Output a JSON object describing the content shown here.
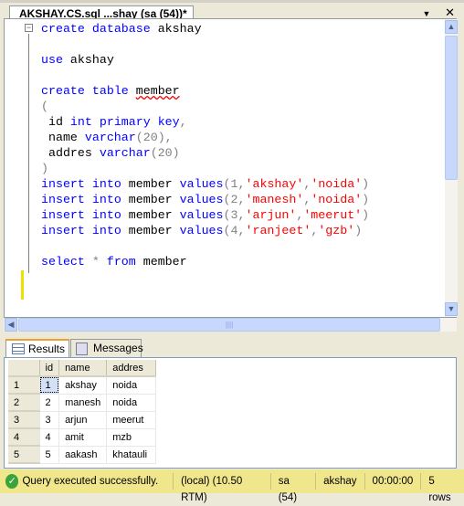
{
  "tab": {
    "title": "AKSHAY.CS.sql ...shay (sa (54))*",
    "dropdown_icon": "▼",
    "close_icon": "✕"
  },
  "code": [
    [
      [
        "create",
        "kw"
      ],
      [
        " ",
        "id"
      ],
      [
        "database",
        "kw"
      ],
      [
        " akshay",
        "id"
      ]
    ],
    [],
    [
      [
        "use",
        "kw"
      ],
      [
        " akshay",
        "id"
      ]
    ],
    [],
    [
      [
        "create",
        "kw"
      ],
      [
        " ",
        "id"
      ],
      [
        "table",
        "kw"
      ],
      [
        " ",
        "id"
      ],
      [
        "member",
        "squig"
      ]
    ],
    [
      [
        "(",
        "pun"
      ]
    ],
    [
      [
        " id ",
        "id"
      ],
      [
        "int",
        "kw"
      ],
      [
        " ",
        "id"
      ],
      [
        "primary",
        "kw"
      ],
      [
        " ",
        "id"
      ],
      [
        "key",
        "kw"
      ],
      [
        ",",
        "pun"
      ]
    ],
    [
      [
        " name ",
        "id"
      ],
      [
        "varchar",
        "kw"
      ],
      [
        "(20),",
        "pun"
      ]
    ],
    [
      [
        " addres ",
        "id"
      ],
      [
        "varchar",
        "kw"
      ],
      [
        "(20)",
        "pun"
      ]
    ],
    [
      [
        ")",
        "pun"
      ]
    ],
    [
      [
        "insert",
        "kw"
      ],
      [
        " ",
        "id"
      ],
      [
        "into",
        "kw"
      ],
      [
        " member ",
        "id"
      ],
      [
        "values",
        "kw"
      ],
      [
        "(1,",
        "pun"
      ],
      [
        "'akshay'",
        "str"
      ],
      [
        ",",
        "pun"
      ],
      [
        "'noida'",
        "str"
      ],
      [
        ")",
        "pun"
      ]
    ],
    [
      [
        "insert",
        "kw"
      ],
      [
        " ",
        "id"
      ],
      [
        "into",
        "kw"
      ],
      [
        " member ",
        "id"
      ],
      [
        "values",
        "kw"
      ],
      [
        "(2,",
        "pun"
      ],
      [
        "'manesh'",
        "str"
      ],
      [
        ",",
        "pun"
      ],
      [
        "'noida'",
        "str"
      ],
      [
        ")",
        "pun"
      ]
    ],
    [
      [
        "insert",
        "kw"
      ],
      [
        " ",
        "id"
      ],
      [
        "into",
        "kw"
      ],
      [
        " member ",
        "id"
      ],
      [
        "values",
        "kw"
      ],
      [
        "(3,",
        "pun"
      ],
      [
        "'arjun'",
        "str"
      ],
      [
        ",",
        "pun"
      ],
      [
        "'meerut'",
        "str"
      ],
      [
        ")",
        "pun"
      ]
    ],
    [
      [
        "insert",
        "kw"
      ],
      [
        " ",
        "id"
      ],
      [
        "into",
        "kw"
      ],
      [
        " member ",
        "id"
      ],
      [
        "values",
        "kw"
      ],
      [
        "(4,",
        "pun"
      ],
      [
        "'ranjeet'",
        "str"
      ],
      [
        ",",
        "pun"
      ],
      [
        "'gzb'",
        "str"
      ],
      [
        ")",
        "pun"
      ]
    ],
    [],
    [
      [
        "select",
        "kw"
      ],
      [
        " ",
        "id"
      ],
      [
        "*",
        "pun"
      ],
      [
        " ",
        "id"
      ],
      [
        "from",
        "kw"
      ],
      [
        " member",
        "id"
      ]
    ]
  ],
  "results_tabs": {
    "results": "Results",
    "messages": "Messages"
  },
  "grid": {
    "columns": [
      "id",
      "name",
      "addres"
    ],
    "rows": [
      [
        "1",
        "1",
        "akshay",
        "noida"
      ],
      [
        "2",
        "2",
        "manesh",
        "noida"
      ],
      [
        "3",
        "3",
        "arjun",
        "meerut"
      ],
      [
        "4",
        "4",
        "amit",
        "mzb"
      ],
      [
        "5",
        "5",
        "aakash",
        "khatauli"
      ]
    ]
  },
  "status": {
    "message": "Query executed successfully.",
    "server": "(local) (10.50 RTM)",
    "user": "sa (54)",
    "database": "akshay",
    "time": "00:00:00",
    "rows": "5 rows"
  },
  "colors": {
    "keyword": "#0000ff",
    "string": "#ff0000",
    "status_bar": "#f0e68c"
  }
}
